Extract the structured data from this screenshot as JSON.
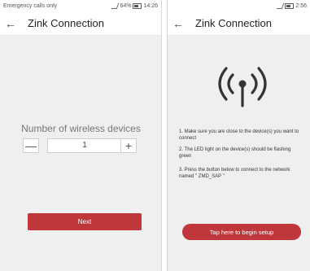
{
  "left": {
    "status": {
      "text": "Emergency calls only",
      "battery": "64%",
      "time": "14:26"
    },
    "header": {
      "title": "Zink Connection"
    },
    "devices_label": "Number of wireless devices",
    "stepper": {
      "minus": "—",
      "value": "1",
      "plus": "+"
    },
    "next_label": "Next"
  },
  "right": {
    "status": {
      "time": "2:56"
    },
    "header": {
      "title": "Zink Connection"
    },
    "instructions": [
      "1. Make sure you are close to the device(s) you want to connect",
      "2. The LED light on the device(s) should be flashing green",
      "3. Press the button below to connect to the network named \" ZMD_SAP \""
    ],
    "setup_label": "Tap here to begin setup"
  },
  "colors": {
    "accent": "#c0373b",
    "background": "#efefef"
  },
  "icons": [
    "back-arrow-icon",
    "wifi-broadcast-icon",
    "signal-icon",
    "battery-icon"
  ]
}
